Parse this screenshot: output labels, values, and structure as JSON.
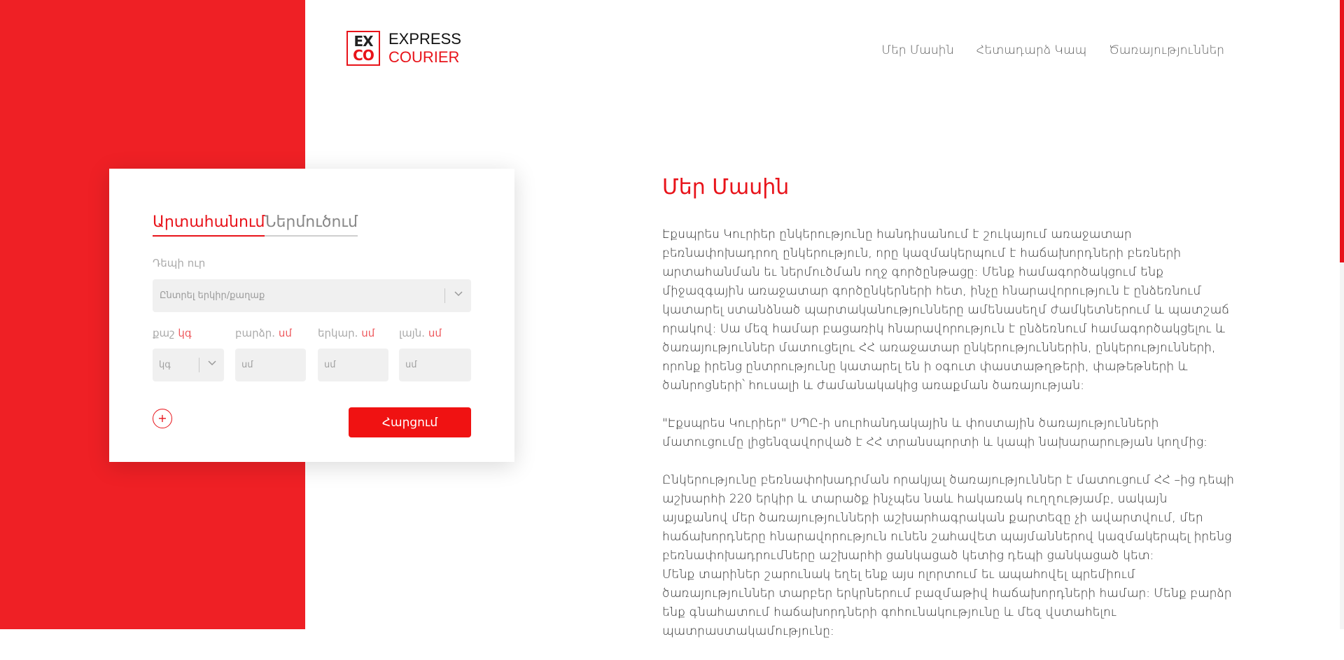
{
  "brand": {
    "mark_line1": "EX",
    "mark_line2": "CO",
    "name_line1": "EXPRESS",
    "name_line2": "COURIER",
    "accent_color": "#e8131a"
  },
  "nav": {
    "items": [
      {
        "label": "Մեր Մասին"
      },
      {
        "label": "Հետադարձ Կապ"
      },
      {
        "label": "Ծառայություններ"
      }
    ]
  },
  "form": {
    "tabs": [
      {
        "label": "Արտահանում",
        "active": true
      },
      {
        "label": "Ներմուծում",
        "active": false
      }
    ],
    "destination_label": "Դեպի ուր",
    "destination_placeholder": "Ընտրել երկիր/քաղաք",
    "fields": [
      {
        "label": "քաշ",
        "unit": "կգ",
        "placeholder": "կգ"
      },
      {
        "label": "բարձր.",
        "unit": "սմ",
        "placeholder": "սմ"
      },
      {
        "label": "երկար.",
        "unit": "սմ",
        "placeholder": "սմ"
      },
      {
        "label": "լայն.",
        "unit": "սմ",
        "placeholder": "սմ"
      }
    ],
    "add_symbol": "+",
    "submit_label": "Հարցում"
  },
  "about": {
    "title": "Մեր Մասին",
    "paragraphs": [
      "Էքսպրես Կուրիեր ընկերությունը  հանդիսանում է շուկայում առաջատար բեռնափոխադրող ընկերություն, որը կազմակերպում  է հաճախորդների բեռների արտահանման եւ ներմուծման ողջ գործընթացը: Մենք համագործակցում ենք միջազգային առաջատար գործընկերների հետ, ինչը հնարավորություն է ընձեռնում կատարել ստանձնած պարտականությունները ամենասեղմ ժամկետներում և պատշաճ որակով: Սա մեզ համար բացառիկ  հնարավորություն է ընձեռնում համագործակցելու և ծառայություններ մատուցելու ՀՀ առաջատար ընկերություններին, ընկերությունների, որոնք իրենց ընտրությունը կատարել են  ի օգուտ փաստաթղթերի, փաթեթների և ծանրոցների՝ հուսալի և ժամանակակից առաքման ծառայության:",
      "\"Էքսպրես Կուրիեր\" ՍՊԸ-ի սուրհանդակային և փոստային ծառայությունների մատուցումը լիցենզավորված է ՀՀ տրանսպորտի և կապի նախարարության կողմից:",
      "Ընկերությունը բեռնափոխադրման որակյալ ծառայություններ է մատուցում ՀՀ –ից դեպի աշխարհի 220 երկիր և տարածք ինչպես նաև հակառակ ուղղությամբ, սակայն այսքանով մեր ծառայությունների աշխարհագրական քարտեզը չի ավարտվում, մեր հաճախորդները հնարավորություն ունեն շահավետ պայմաններով կազմակերպել իրենց բեռնափոխադրումները աշխարհի ցանկացած կետից դեպի ցանկացած կետ:",
      "Մենք տարիներ շարունակ եղել ենք այս ոլորտում եւ ապահովել պրեմիում ծառայություններ տարբեր երկրներում բազմաթիվ հաճախորդների համար: Մենք բարձր ենք գնահատում հաճախորդների գոհունակությունը և մեզ վստահելու պատրաստակամությունը:"
    ]
  }
}
